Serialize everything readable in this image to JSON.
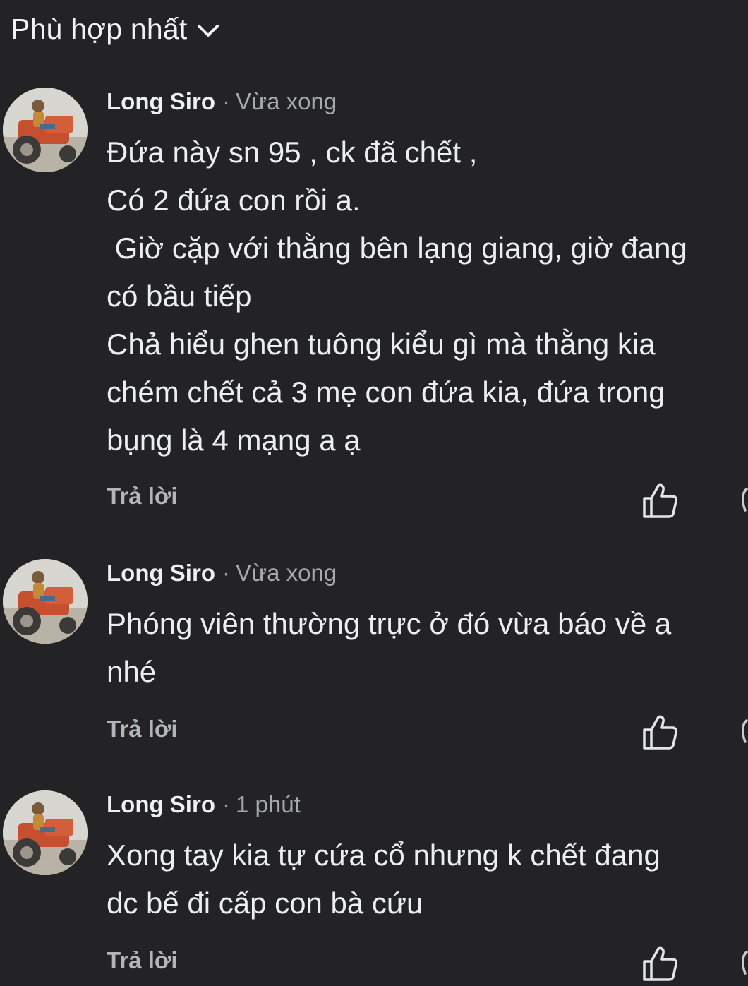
{
  "header": {
    "sort_label": "Phù hợp nhất",
    "sort_icon": "chevron-down-icon"
  },
  "comments": [
    {
      "author": "Long Siro",
      "separator": "·",
      "time": "Vừa xong",
      "text": "Đứa này sn 95 , ck đã chết ,\nCó 2 đứa con rồi a.\n Giờ cặp với thằng bên lạng giang, giờ đang\ncó bầu tiếp\nChả hiểu ghen tuông kiểu gì mà thằng kia\nchém chết cả 3 mẹ con đứa kia, đứa trong\nbụng là 4 mạng a ạ",
      "reply_label": "Trả lời",
      "like_icon": "thumbs-up-icon"
    },
    {
      "author": "Long Siro",
      "separator": "·",
      "time": "Vừa xong",
      "text": "Phóng viên thường trực ở đó vừa báo về a\nnhé",
      "reply_label": "Trả lời",
      "like_icon": "thumbs-up-icon"
    },
    {
      "author": "Long Siro",
      "separator": "·",
      "time": "1 phút",
      "text": "Xong tay kia tự cứa cổ nhưng k chết đang\ndc bế đi cấp con bà cứu",
      "reply_label": "Trả lời",
      "like_icon": "thumbs-up-icon"
    }
  ],
  "colors": {
    "background": "#232325",
    "text": "#eceef0",
    "muted": "#a6a9ae"
  }
}
